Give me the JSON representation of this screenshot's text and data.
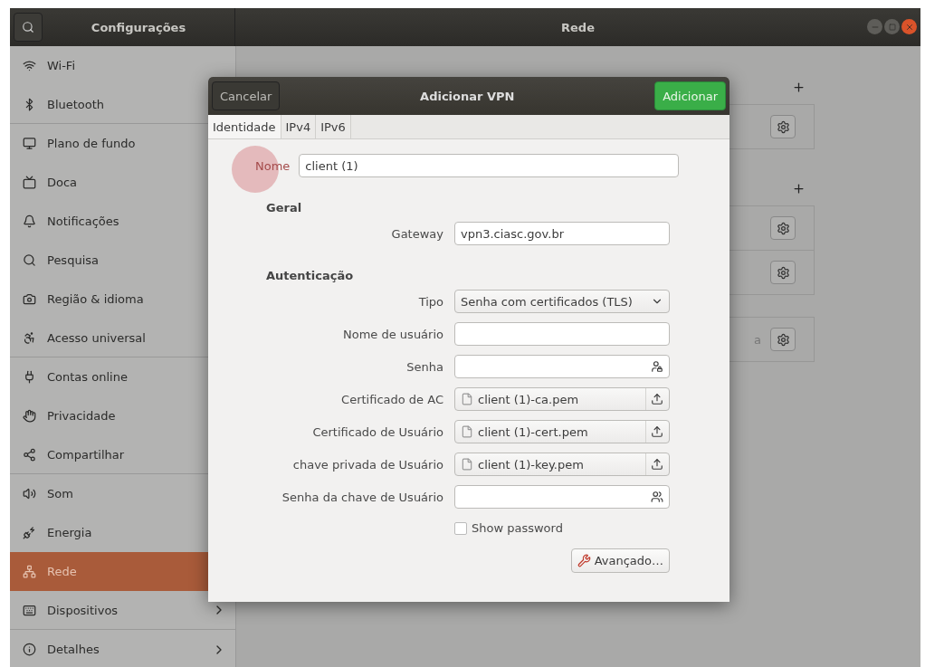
{
  "window": {
    "sidebar_title": "Configurações",
    "title": "Rede"
  },
  "sidebar": {
    "items": [
      {
        "label": "Wi-Fi",
        "selected": false,
        "group_end": false
      },
      {
        "label": "Bluetooth",
        "selected": false,
        "group_end": true
      },
      {
        "label": "Plano de fundo",
        "selected": false,
        "group_end": false
      },
      {
        "label": "Doca",
        "selected": false,
        "group_end": false
      },
      {
        "label": "Notificações",
        "selected": false,
        "group_end": false
      },
      {
        "label": "Pesquisa",
        "selected": false,
        "group_end": false
      },
      {
        "label": "Região & idioma",
        "selected": false,
        "group_end": false
      },
      {
        "label": "Acesso universal",
        "selected": false,
        "group_end": true
      },
      {
        "label": "Contas online",
        "selected": false,
        "group_end": false
      },
      {
        "label": "Privacidade",
        "selected": false,
        "group_end": false
      },
      {
        "label": "Compartilhar",
        "selected": false,
        "group_end": true
      },
      {
        "label": "Som",
        "selected": false,
        "group_end": false
      },
      {
        "label": "Energia",
        "selected": false,
        "group_end": false
      },
      {
        "label": "Rede",
        "selected": true,
        "group_end": false
      },
      {
        "label": "Dispositivos",
        "selected": false,
        "arrow": true,
        "group_end": true
      },
      {
        "label": "Detalhes",
        "selected": false,
        "arrow": true,
        "group_end": false
      }
    ]
  },
  "network_panel": {
    "sections": [
      {
        "rows": [
          {
            "kind": "row"
          }
        ]
      },
      {
        "rows": [
          {
            "kind": "row"
          },
          {
            "kind": "row"
          }
        ]
      },
      {
        "rows": [
          {
            "kind": "row",
            "text": "a"
          }
        ]
      }
    ]
  },
  "dialog": {
    "title": "Adicionar VPN",
    "cancel": "Cancelar",
    "confirm": "Adicionar",
    "tabs": [
      {
        "label": "Identidade",
        "selected": true
      },
      {
        "label": "IPv4",
        "selected": false
      },
      {
        "label": "IPv6",
        "selected": false
      }
    ],
    "name_label": "Nome",
    "name_value": "client (1)",
    "sections": [
      {
        "heading": "Geral",
        "fields": [
          {
            "label": "Gateway",
            "kind": "entry",
            "value": "vpn3.ciasc.gov.br"
          }
        ]
      },
      {
        "heading": "Autenticação",
        "fields": [
          {
            "label": "Tipo",
            "kind": "combo",
            "value": "Senha com certificados (TLS)"
          },
          {
            "label": "Nome de usuário",
            "kind": "entry"
          },
          {
            "label": "Senha",
            "kind": "password"
          },
          {
            "label": "Certificado de AC",
            "kind": "file",
            "value": "client (1)-ca.pem"
          },
          {
            "label": "Certificado de Usuário",
            "kind": "file",
            "value": "client (1)-cert.pem"
          },
          {
            "label": "chave privada de Usuário",
            "kind": "file",
            "value": "client (1)-key.pem"
          },
          {
            "label": "Senha da chave de Usuário",
            "kind": "password_ask"
          }
        ]
      }
    ],
    "show_password": {
      "label": "Show password",
      "checked": false
    },
    "advanced": "Avançado…"
  }
}
